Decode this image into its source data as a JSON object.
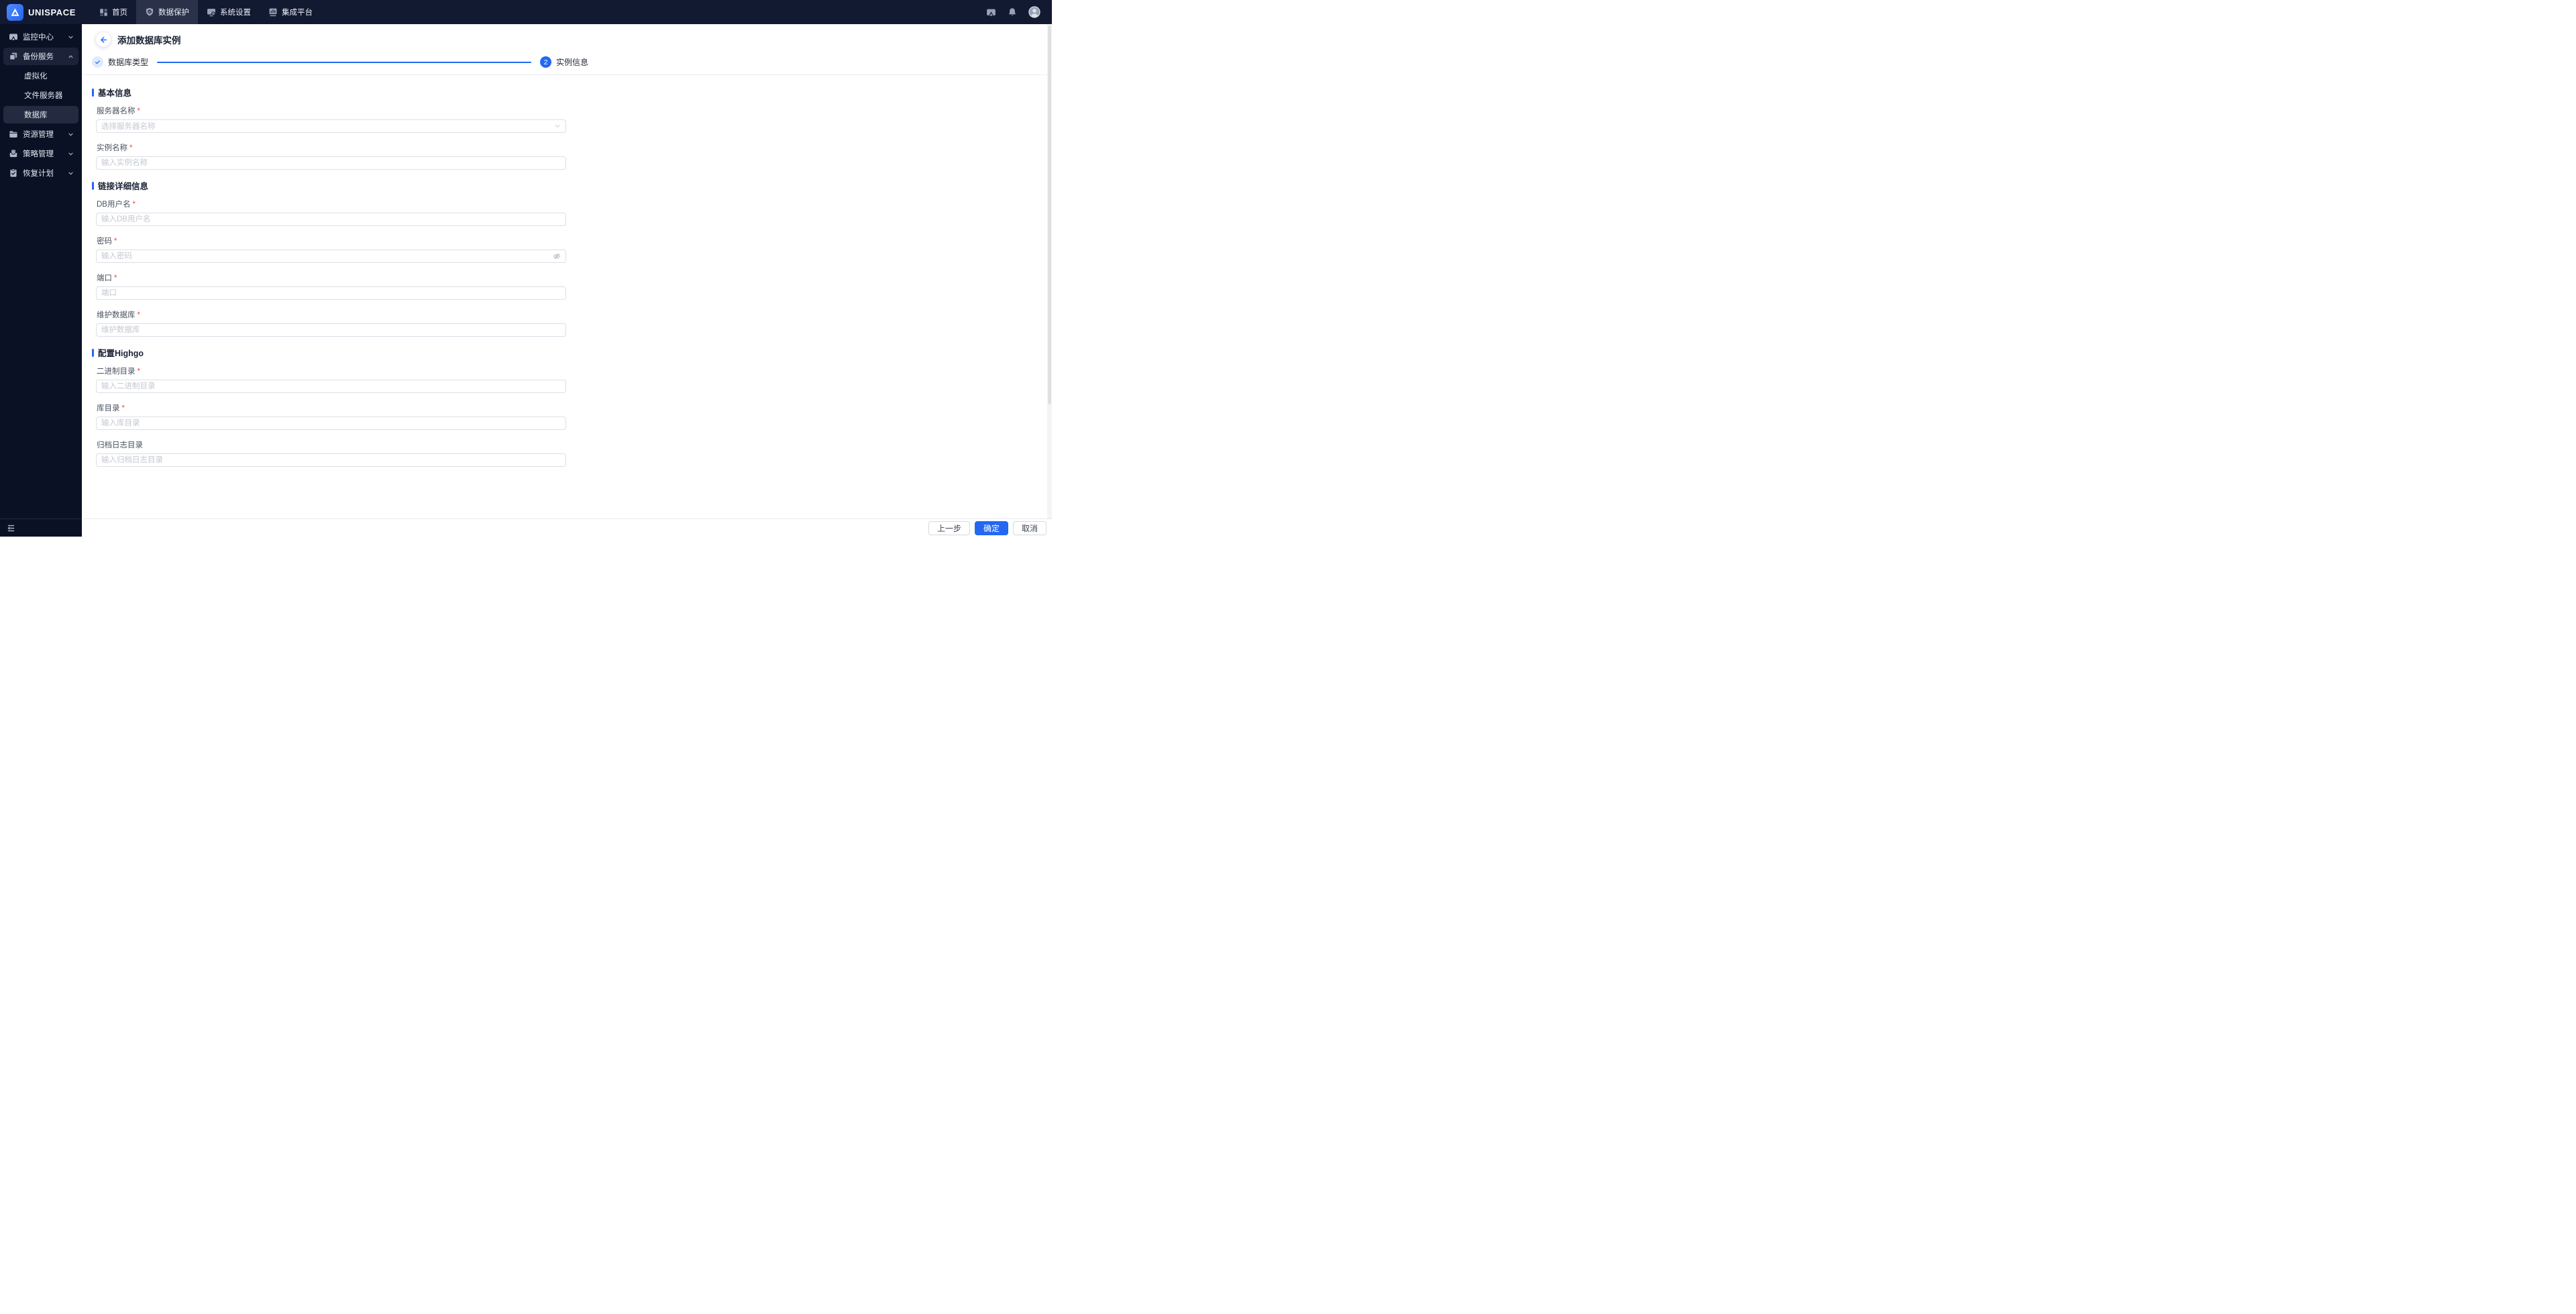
{
  "header": {
    "logo_text": "UNISPACE",
    "nav": [
      {
        "name": "home",
        "icon": "dashboard",
        "label": "首页",
        "active": false
      },
      {
        "name": "data-protection",
        "icon": "shield",
        "label": "数据保护",
        "active": true
      },
      {
        "name": "system-settings",
        "icon": "monitor-gear",
        "label": "系统设置",
        "active": false
      },
      {
        "name": "integration-platform",
        "icon": "monitor-chart",
        "label": "集成平台",
        "active": false
      }
    ],
    "right_icons": [
      "cast-icon",
      "bell-icon",
      "avatar"
    ]
  },
  "sidebar": {
    "items": [
      {
        "name": "monitoring-center",
        "icon": "cast",
        "label": "监控中心",
        "chevron": "down",
        "type": "group"
      },
      {
        "name": "backup-service",
        "icon": "copy",
        "label": "备份服务",
        "chevron": "up",
        "type": "group",
        "highlight": true
      },
      {
        "name": "virtualization",
        "label": "虚拟化",
        "type": "sub"
      },
      {
        "name": "file-server",
        "label": "文件服务器",
        "type": "sub"
      },
      {
        "name": "database",
        "label": "数据库",
        "type": "sub",
        "active": true
      },
      {
        "name": "resource-management",
        "icon": "folder",
        "label": "资源管理",
        "chevron": "down",
        "type": "group"
      },
      {
        "name": "policy-management",
        "icon": "archive",
        "label": "策略管理",
        "chevron": "down",
        "type": "group"
      },
      {
        "name": "recovery-plan",
        "icon": "clipboard",
        "label": "恢复计划",
        "chevron": "down",
        "type": "group"
      }
    ],
    "collapse_icon": "collapse-sidebar-icon"
  },
  "page": {
    "title": "添加数据库实例",
    "stepper": {
      "steps": [
        {
          "label": "数据库类型",
          "state": "done"
        },
        {
          "label": "实例信息",
          "state": "current",
          "number": "2"
        }
      ]
    },
    "sections": [
      {
        "title": "基本信息",
        "fields": [
          {
            "name": "server-name",
            "label": "服务器名称",
            "required": true,
            "control": "select",
            "placeholder": "选择服务器名称"
          },
          {
            "name": "instance-name",
            "label": "实例名称",
            "required": true,
            "control": "text",
            "placeholder": "输入实例名称"
          }
        ]
      },
      {
        "title": "链接详细信息",
        "fields": [
          {
            "name": "db-username",
            "label": "DB用户名",
            "required": true,
            "control": "text",
            "placeholder": "输入DB用户名"
          },
          {
            "name": "password",
            "label": "密码",
            "required": true,
            "control": "password",
            "placeholder": "输入密码"
          },
          {
            "name": "port",
            "label": "端口",
            "required": true,
            "control": "text",
            "placeholder": "端口"
          },
          {
            "name": "maintenance-db",
            "label": "维护数据库",
            "required": true,
            "control": "text",
            "placeholder": "维护数据库"
          }
        ]
      },
      {
        "title": "配置Highgo",
        "fields": [
          {
            "name": "binary-dir",
            "label": "二进制目录",
            "required": true,
            "control": "text",
            "placeholder": "输入二进制目录"
          },
          {
            "name": "lib-dir",
            "label": "库目录",
            "required": true,
            "control": "text",
            "placeholder": "输入库目录"
          },
          {
            "name": "archive-log-dir",
            "label": "归档日志目录",
            "required": false,
            "control": "text",
            "placeholder": "输入归档日志目录"
          }
        ]
      }
    ],
    "footer_buttons": [
      {
        "name": "prev-step-button",
        "label": "上一步",
        "type": "default"
      },
      {
        "name": "confirm-button",
        "label": "确定",
        "type": "primary"
      },
      {
        "name": "cancel-button",
        "label": "取消",
        "type": "default"
      }
    ]
  },
  "misc": {
    "required_mark": "*"
  },
  "colors": {
    "accent": "#2468f2",
    "header_bg": "#121a31",
    "sidebar_bg": "#0a1124",
    "active_tab_bg": "#2a3148",
    "sidebar_highlight_bg": "#1c2338",
    "sidebar_active_bg": "#242b40",
    "required_mark": "#f2493d",
    "input_border": "#dcdfe6",
    "placeholder": "#c3c8d1"
  }
}
